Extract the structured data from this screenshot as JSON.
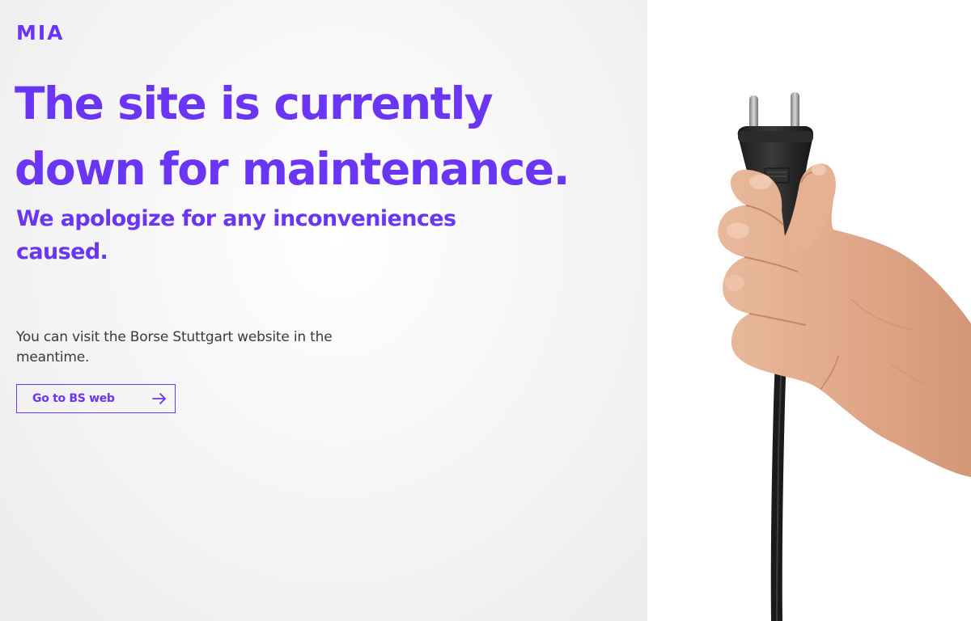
{
  "brand": {
    "logo_text": "MIA",
    "accent_color": "#6a35f5"
  },
  "main": {
    "headline": "The site is currently down for maintenance.",
    "subheadline": "We apologize for any inconveniences caused.",
    "body_text": "You can visit the Borse Stuttgart website in the meantime.",
    "cta": {
      "label": "Go to BS web",
      "icon": "arrow-right-icon"
    }
  },
  "hero_image": {
    "subject": "hand-holding-power-plug"
  }
}
